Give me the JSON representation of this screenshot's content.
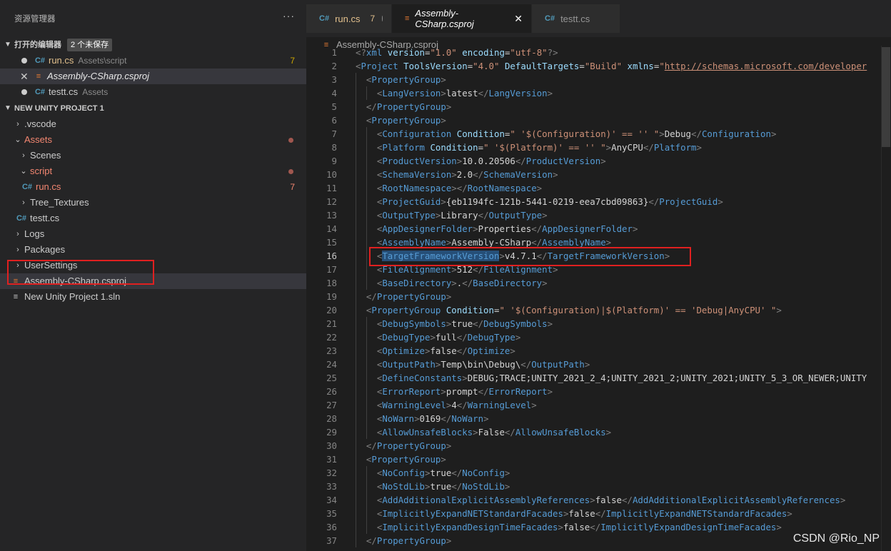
{
  "sidebar": {
    "title": "资源管理器",
    "more_label": "···",
    "open_editors": {
      "title": "打开的编辑器",
      "badge": "2 个未保存",
      "items": [
        {
          "name": "run.cs",
          "desc": "Assets\\script",
          "count": "7"
        },
        {
          "name": "Assembly-CSharp.csproj"
        },
        {
          "name": "testt.cs",
          "desc": "Assets"
        }
      ]
    },
    "project": {
      "title": "NEW UNITY PROJECT 1",
      "items": [
        {
          "label": ".vscode"
        },
        {
          "label": "Assets"
        },
        {
          "label": "Scenes"
        },
        {
          "label": "script"
        },
        {
          "label": "run.cs",
          "count": "7"
        },
        {
          "label": "Tree_Textures"
        },
        {
          "label": "testt.cs"
        },
        {
          "label": "Logs"
        },
        {
          "label": "Packages"
        },
        {
          "label": "UserSettings"
        },
        {
          "label": "Assembly-CSharp.csproj"
        },
        {
          "label": "New Unity Project 1.sln"
        }
      ]
    }
  },
  "tabs": [
    {
      "name": "run.cs",
      "count": "7"
    },
    {
      "name": "Assembly-CSharp.csproj",
      "close": "✕"
    },
    {
      "name": "testt.cs"
    }
  ],
  "breadcrumb": "Assembly-CSharp.csproj",
  "code": {
    "current_line": 16,
    "lines": [
      [
        [
          "b",
          "<?"
        ],
        [
          "tag",
          "xml"
        ],
        [
          "t",
          " "
        ],
        [
          "attr",
          "version"
        ],
        [
          "t",
          "="
        ],
        [
          "str",
          "\"1.0\""
        ],
        [
          "t",
          " "
        ],
        [
          "attr",
          "encoding"
        ],
        [
          "t",
          "="
        ],
        [
          "str",
          "\"utf-8\""
        ],
        [
          "b",
          "?>"
        ]
      ],
      [
        [
          "b",
          "<"
        ],
        [
          "tag",
          "Project"
        ],
        [
          "t",
          " "
        ],
        [
          "attr",
          "ToolsVersion"
        ],
        [
          "t",
          "="
        ],
        [
          "str",
          "\"4.0\""
        ],
        [
          "t",
          " "
        ],
        [
          "attr",
          "DefaultTargets"
        ],
        [
          "t",
          "="
        ],
        [
          "str",
          "\"Build\""
        ],
        [
          "t",
          " "
        ],
        [
          "attr",
          "xmlns"
        ],
        [
          "t",
          "="
        ],
        [
          "str",
          "\""
        ],
        [
          "url",
          "http://schemas.microsoft.com/developer"
        ]
      ],
      [
        [
          "b",
          "<"
        ],
        [
          "tag",
          "PropertyGroup"
        ],
        [
          "b",
          ">"
        ]
      ],
      [
        [
          "b",
          "<"
        ],
        [
          "tag",
          "LangVersion"
        ],
        [
          "b",
          ">"
        ],
        [
          "t",
          "latest"
        ],
        [
          "b",
          "</"
        ],
        [
          "tag",
          "LangVersion"
        ],
        [
          "b",
          ">"
        ]
      ],
      [
        [
          "b",
          "</"
        ],
        [
          "tag",
          "PropertyGroup"
        ],
        [
          "b",
          ">"
        ]
      ],
      [
        [
          "b",
          "<"
        ],
        [
          "tag",
          "PropertyGroup"
        ],
        [
          "b",
          ">"
        ]
      ],
      [
        [
          "b",
          "<"
        ],
        [
          "tag",
          "Configuration"
        ],
        [
          "t",
          " "
        ],
        [
          "attr",
          "Condition"
        ],
        [
          "t",
          "="
        ],
        [
          "str",
          "\" '$(Configuration)' == '' \""
        ],
        [
          "b",
          ">"
        ],
        [
          "t",
          "Debug"
        ],
        [
          "b",
          "</"
        ],
        [
          "tag",
          "Configuration"
        ],
        [
          "b",
          ">"
        ]
      ],
      [
        [
          "b",
          "<"
        ],
        [
          "tag",
          "Platform"
        ],
        [
          "t",
          " "
        ],
        [
          "attr",
          "Condition"
        ],
        [
          "t",
          "="
        ],
        [
          "str",
          "\" '$(Platform)' == '' \""
        ],
        [
          "b",
          ">"
        ],
        [
          "t",
          "AnyCPU"
        ],
        [
          "b",
          "</"
        ],
        [
          "tag",
          "Platform"
        ],
        [
          "b",
          ">"
        ]
      ],
      [
        [
          "b",
          "<"
        ],
        [
          "tag",
          "ProductVersion"
        ],
        [
          "b",
          ">"
        ],
        [
          "t",
          "10.0.20506"
        ],
        [
          "b",
          "</"
        ],
        [
          "tag",
          "ProductVersion"
        ],
        [
          "b",
          ">"
        ]
      ],
      [
        [
          "b",
          "<"
        ],
        [
          "tag",
          "SchemaVersion"
        ],
        [
          "b",
          ">"
        ],
        [
          "t",
          "2.0"
        ],
        [
          "b",
          "</"
        ],
        [
          "tag",
          "SchemaVersion"
        ],
        [
          "b",
          ">"
        ]
      ],
      [
        [
          "b",
          "<"
        ],
        [
          "tag",
          "RootNamespace"
        ],
        [
          "b",
          "></"
        ],
        [
          "tag",
          "RootNamespace"
        ],
        [
          "b",
          ">"
        ]
      ],
      [
        [
          "b",
          "<"
        ],
        [
          "tag",
          "ProjectGuid"
        ],
        [
          "b",
          ">"
        ],
        [
          "t",
          "{eb1194fc-121b-5441-0219-eea7cbd09863}"
        ],
        [
          "b",
          "</"
        ],
        [
          "tag",
          "ProjectGuid"
        ],
        [
          "b",
          ">"
        ]
      ],
      [
        [
          "b",
          "<"
        ],
        [
          "tag",
          "OutputType"
        ],
        [
          "b",
          ">"
        ],
        [
          "t",
          "Library"
        ],
        [
          "b",
          "</"
        ],
        [
          "tag",
          "OutputType"
        ],
        [
          "b",
          ">"
        ]
      ],
      [
        [
          "b",
          "<"
        ],
        [
          "tag",
          "AppDesignerFolder"
        ],
        [
          "b",
          ">"
        ],
        [
          "t",
          "Properties"
        ],
        [
          "b",
          "</"
        ],
        [
          "tag",
          "AppDesignerFolder"
        ],
        [
          "b",
          ">"
        ]
      ],
      [
        [
          "b",
          "<"
        ],
        [
          "tag",
          "AssemblyName"
        ],
        [
          "b",
          ">"
        ],
        [
          "t",
          "Assembly-CSharp"
        ],
        [
          "b",
          "</"
        ],
        [
          "tag",
          "AssemblyName"
        ],
        [
          "b",
          ">"
        ]
      ],
      [
        [
          "b",
          "<"
        ],
        [
          "tag",
          "TargetFrameworkVersion"
        ],
        [
          "b",
          ">"
        ],
        [
          "t",
          "v4.7.1"
        ],
        [
          "b",
          "</"
        ],
        [
          "tag",
          "TargetFrameworkVersion"
        ],
        [
          "b",
          ">"
        ]
      ],
      [
        [
          "b",
          "<"
        ],
        [
          "tag",
          "FileAlignment"
        ],
        [
          "b",
          ">"
        ],
        [
          "t",
          "512"
        ],
        [
          "b",
          "</"
        ],
        [
          "tag",
          "FileAlignment"
        ],
        [
          "b",
          ">"
        ]
      ],
      [
        [
          "b",
          "<"
        ],
        [
          "tag",
          "BaseDirectory"
        ],
        [
          "b",
          ">"
        ],
        [
          "t",
          "."
        ],
        [
          "b",
          "</"
        ],
        [
          "tag",
          "BaseDirectory"
        ],
        [
          "b",
          ">"
        ]
      ],
      [
        [
          "b",
          "</"
        ],
        [
          "tag",
          "PropertyGroup"
        ],
        [
          "b",
          ">"
        ]
      ],
      [
        [
          "b",
          "<"
        ],
        [
          "tag",
          "PropertyGroup"
        ],
        [
          "t",
          " "
        ],
        [
          "attr",
          "Condition"
        ],
        [
          "t",
          "="
        ],
        [
          "str",
          "\" '$(Configuration)|$(Platform)' == 'Debug|AnyCPU' \""
        ],
        [
          "b",
          ">"
        ]
      ],
      [
        [
          "b",
          "<"
        ],
        [
          "tag",
          "DebugSymbols"
        ],
        [
          "b",
          ">"
        ],
        [
          "t",
          "true"
        ],
        [
          "b",
          "</"
        ],
        [
          "tag",
          "DebugSymbols"
        ],
        [
          "b",
          ">"
        ]
      ],
      [
        [
          "b",
          "<"
        ],
        [
          "tag",
          "DebugType"
        ],
        [
          "b",
          ">"
        ],
        [
          "t",
          "full"
        ],
        [
          "b",
          "</"
        ],
        [
          "tag",
          "DebugType"
        ],
        [
          "b",
          ">"
        ]
      ],
      [
        [
          "b",
          "<"
        ],
        [
          "tag",
          "Optimize"
        ],
        [
          "b",
          ">"
        ],
        [
          "t",
          "false"
        ],
        [
          "b",
          "</"
        ],
        [
          "tag",
          "Optimize"
        ],
        [
          "b",
          ">"
        ]
      ],
      [
        [
          "b",
          "<"
        ],
        [
          "tag",
          "OutputPath"
        ],
        [
          "b",
          ">"
        ],
        [
          "t",
          "Temp\\bin\\Debug\\"
        ],
        [
          "b",
          "</"
        ],
        [
          "tag",
          "OutputPath"
        ],
        [
          "b",
          ">"
        ]
      ],
      [
        [
          "b",
          "<"
        ],
        [
          "tag",
          "DefineConstants"
        ],
        [
          "b",
          ">"
        ],
        [
          "t",
          "DEBUG;TRACE;UNITY_2021_2_4;UNITY_2021_2;UNITY_2021;UNITY_5_3_OR_NEWER;UNITY"
        ]
      ],
      [
        [
          "b",
          "<"
        ],
        [
          "tag",
          "ErrorReport"
        ],
        [
          "b",
          ">"
        ],
        [
          "t",
          "prompt"
        ],
        [
          "b",
          "</"
        ],
        [
          "tag",
          "ErrorReport"
        ],
        [
          "b",
          ">"
        ]
      ],
      [
        [
          "b",
          "<"
        ],
        [
          "tag",
          "WarningLevel"
        ],
        [
          "b",
          ">"
        ],
        [
          "t",
          "4"
        ],
        [
          "b",
          "</"
        ],
        [
          "tag",
          "WarningLevel"
        ],
        [
          "b",
          ">"
        ]
      ],
      [
        [
          "b",
          "<"
        ],
        [
          "tag",
          "NoWarn"
        ],
        [
          "b",
          ">"
        ],
        [
          "t",
          "0169"
        ],
        [
          "b",
          "</"
        ],
        [
          "tag",
          "NoWarn"
        ],
        [
          "b",
          ">"
        ]
      ],
      [
        [
          "b",
          "<"
        ],
        [
          "tag",
          "AllowUnsafeBlocks"
        ],
        [
          "b",
          ">"
        ],
        [
          "t",
          "False"
        ],
        [
          "b",
          "</"
        ],
        [
          "tag",
          "AllowUnsafeBlocks"
        ],
        [
          "b",
          ">"
        ]
      ],
      [
        [
          "b",
          "</"
        ],
        [
          "tag",
          "PropertyGroup"
        ],
        [
          "b",
          ">"
        ]
      ],
      [
        [
          "b",
          "<"
        ],
        [
          "tag",
          "PropertyGroup"
        ],
        [
          "b",
          ">"
        ]
      ],
      [
        [
          "b",
          "<"
        ],
        [
          "tag",
          "NoConfig"
        ],
        [
          "b",
          ">"
        ],
        [
          "t",
          "true"
        ],
        [
          "b",
          "</"
        ],
        [
          "tag",
          "NoConfig"
        ],
        [
          "b",
          ">"
        ]
      ],
      [
        [
          "b",
          "<"
        ],
        [
          "tag",
          "NoStdLib"
        ],
        [
          "b",
          ">"
        ],
        [
          "t",
          "true"
        ],
        [
          "b",
          "</"
        ],
        [
          "tag",
          "NoStdLib"
        ],
        [
          "b",
          ">"
        ]
      ],
      [
        [
          "b",
          "<"
        ],
        [
          "tag",
          "AddAdditionalExplicitAssemblyReferences"
        ],
        [
          "b",
          ">"
        ],
        [
          "t",
          "false"
        ],
        [
          "b",
          "</"
        ],
        [
          "tag",
          "AddAdditionalExplicitAssemblyReferences"
        ],
        [
          "b",
          ">"
        ]
      ],
      [
        [
          "b",
          "<"
        ],
        [
          "tag",
          "ImplicitlyExpandNETStandardFacades"
        ],
        [
          "b",
          ">"
        ],
        [
          "t",
          "false"
        ],
        [
          "b",
          "</"
        ],
        [
          "tag",
          "ImplicitlyExpandNETStandardFacades"
        ],
        [
          "b",
          ">"
        ]
      ],
      [
        [
          "b",
          "<"
        ],
        [
          "tag",
          "ImplicitlyExpandDesignTimeFacades"
        ],
        [
          "b",
          ">"
        ],
        [
          "t",
          "false"
        ],
        [
          "b",
          "</"
        ],
        [
          "tag",
          "ImplicitlyExpandDesignTimeFacades"
        ],
        [
          "b",
          ">"
        ]
      ],
      [
        [
          "b",
          "</"
        ],
        [
          "tag",
          "PropertyGroup"
        ],
        [
          "b",
          ">"
        ]
      ]
    ]
  },
  "watermark": "CSDN @Rio_NP",
  "colors": {
    "highlight_box": "#e02020",
    "accent_modified": "#e2c08d",
    "accent_error": "#f48771"
  },
  "icons": {
    "cs": "csharp-file-icon",
    "csproj": "rss-file-icon"
  }
}
